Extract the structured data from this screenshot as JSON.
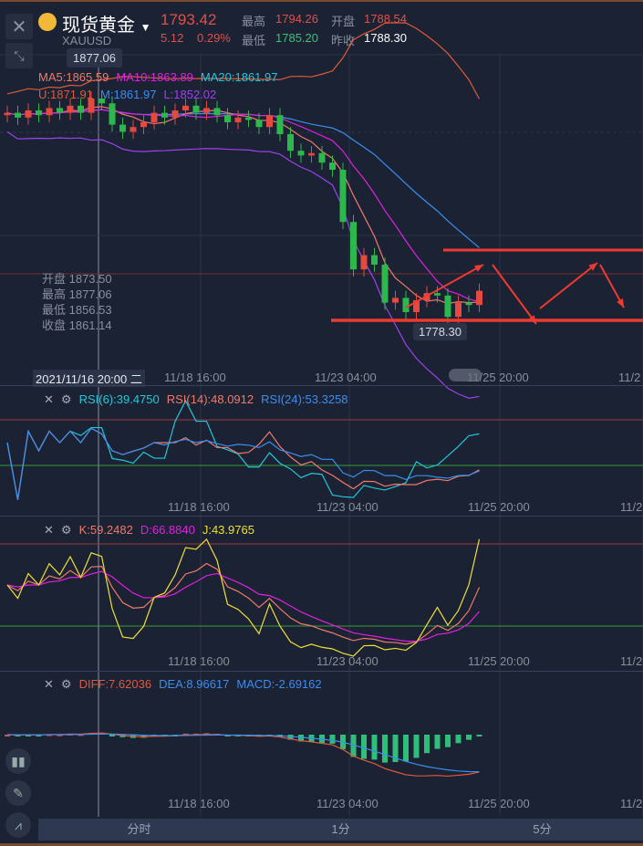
{
  "header": {
    "title": "现货黄金",
    "symbol": "XAUUSD",
    "last": "1793.42",
    "change": "5.12",
    "change_pct": "0.29%",
    "high_label": "最高",
    "high": "1794.26",
    "open_label": "开盘",
    "open": "1788.54",
    "low_label": "最低",
    "low": "1785.20",
    "prev_label": "昨收",
    "prev": "1788.30"
  },
  "main": {
    "crosshair_price": "1877.06",
    "low_marker": "1778.30",
    "ma": {
      "ma5": "MA5:1865.59",
      "ma10": "MA10:1863.89",
      "ma20": "MA20:1861.97"
    },
    "boll": {
      "u": "U:1871.91",
      "m": "M:1861.97",
      "l": "L:1852.02"
    },
    "ohlc": [
      "开盘 1873.50",
      "最高 1877.06",
      "最低 1856.53",
      "收盘 1861.14"
    ],
    "time_axis": [
      "2021/11/16 20:00 二",
      "11/18 16:00",
      "11/23 04:00",
      "11/25 20:00",
      "11/2"
    ]
  },
  "rsi": {
    "rsi6": "RSI(6):39.4750",
    "rsi14": "RSI(14):48.0912",
    "rsi24": "RSI(24):53.3258"
  },
  "kdj": {
    "k": "K:59.2482",
    "d": "D:66.8840",
    "j": "J:43.9765"
  },
  "macd": {
    "diff": "DIFF:7.62036",
    "dea": "DEA:8.96617",
    "macd": "MACD:-2.69162"
  },
  "sub_axis": [
    "11/18 16:00",
    "11/23 04:00",
    "11/25 20:00",
    "11/2"
  ],
  "tabs": [
    "分时",
    "1分",
    "5分"
  ],
  "colors": {
    "up": "#e5493f",
    "down": "#2db84c",
    "ma5": "#f07a6a",
    "ma10": "#e020e0",
    "ma20": "#1fc8d8",
    "boll_u": "#e05a3a",
    "boll_m": "#3a8ef0",
    "boll_l": "#a040f0"
  },
  "chart_data": {
    "type": "candlestick",
    "closes": [
      1866,
      1864,
      1867,
      1865,
      1868,
      1866,
      1869,
      1866,
      1872,
      1870,
      1861,
      1858,
      1860,
      1862,
      1866,
      1864,
      1867,
      1869,
      1866,
      1868,
      1865,
      1862,
      1864,
      1863,
      1860,
      1865,
      1857,
      1850,
      1848,
      1849,
      1845,
      1842,
      1820,
      1800,
      1806,
      1802,
      1786,
      1788,
      1782,
      1787,
      1790,
      1789,
      1780,
      1786,
      1785,
      1791
    ]
  }
}
